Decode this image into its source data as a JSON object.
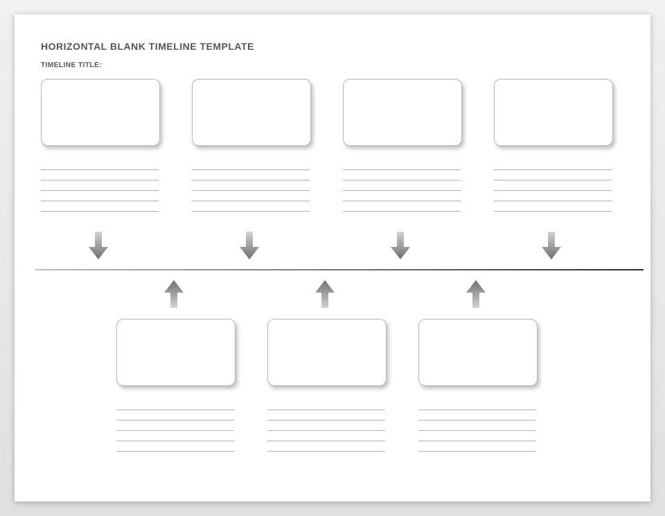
{
  "header": {
    "title": "HORIZONTAL BLANK TIMELINE TEMPLATE",
    "subtitle": "TIMELINE TITLE:"
  },
  "top_items": [
    {
      "card_text": "",
      "lines": [
        "",
        "",
        "",
        "",
        ""
      ]
    },
    {
      "card_text": "",
      "lines": [
        "",
        "",
        "",
        "",
        ""
      ]
    },
    {
      "card_text": "",
      "lines": [
        "",
        "",
        "",
        "",
        ""
      ]
    },
    {
      "card_text": "",
      "lines": [
        "",
        "",
        "",
        "",
        ""
      ]
    }
  ],
  "bottom_items": [
    {
      "card_text": "",
      "lines": [
        "",
        "",
        "",
        "",
        ""
      ]
    },
    {
      "card_text": "",
      "lines": [
        "",
        "",
        "",
        "",
        ""
      ]
    },
    {
      "card_text": "",
      "lines": [
        "",
        "",
        "",
        "",
        ""
      ]
    }
  ]
}
